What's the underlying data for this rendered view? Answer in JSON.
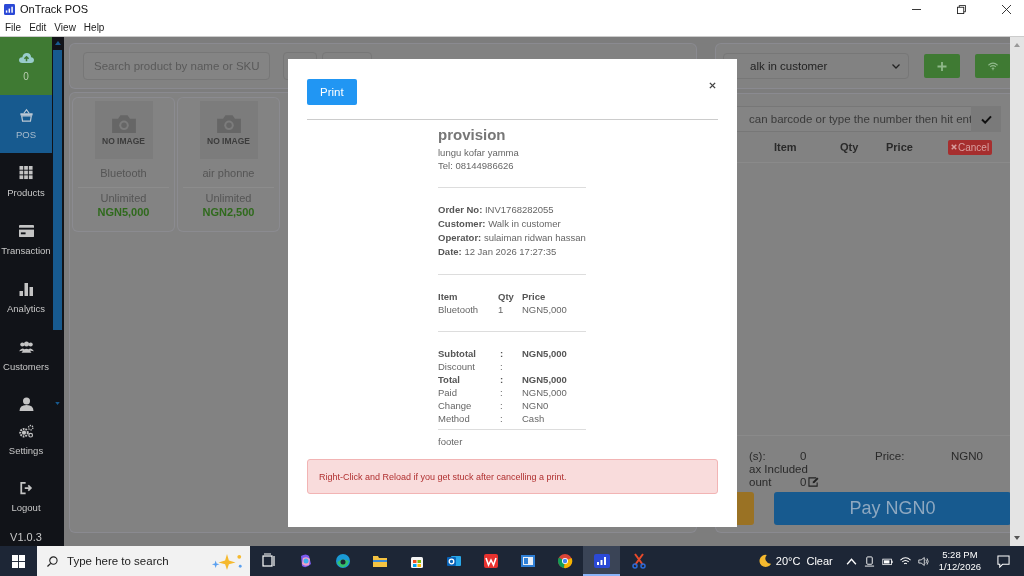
{
  "window": {
    "title": "OnTrack POS"
  },
  "menu": [
    "File",
    "Edit",
    "View",
    "Help"
  ],
  "sidebar": {
    "sync": {
      "count": "0"
    },
    "items": [
      {
        "label": "POS",
        "kind": "basket",
        "selected": true
      },
      {
        "label": "Products",
        "kind": "grid",
        "selected": false
      },
      {
        "label": "Transaction",
        "kind": "card",
        "selected": false
      },
      {
        "label": "Analytics",
        "kind": "bars",
        "selected": false
      },
      {
        "label": "Customers",
        "kind": "users",
        "selected": false
      }
    ],
    "bottom_items": [
      {
        "label": "Settings",
        "kind": "gears",
        "selected": false
      },
      {
        "label": "Logout",
        "kind": "logout",
        "selected": false
      }
    ],
    "version": "V1.0.3"
  },
  "products": {
    "search": {
      "placeholder": "Search product by name or SKU"
    },
    "items": [
      {
        "image_text": "NO IMAGE",
        "name": "Bluetooth",
        "stock": "Unlimited",
        "price": "NGN5,000"
      },
      {
        "image_text": "NO IMAGE",
        "name": "air phonne",
        "stock": "Unlimited",
        "price": "NGN2,500"
      }
    ]
  },
  "cart": {
    "customer": "alk in customer",
    "barcode_placeholder": "can barcode or type the number then hit ent",
    "columns": [
      "Item",
      "Qty",
      "Price"
    ],
    "cancel": "Cancel",
    "summary": {
      "items_label": "(s):",
      "items_value": "0",
      "price_label": "Price:",
      "price_value": "NGN0",
      "tax_label": "ax Included",
      "discount_label": "ount",
      "discount_value": "0"
    },
    "pay": "Pay NGN0"
  },
  "modal": {
    "print": "Print",
    "receipt": {
      "store": "provision",
      "address": "lungu kofar yamma",
      "phone": "Tel: 08144986626",
      "info": [
        {
          "label": "Order No:",
          "value": "INV1768282055"
        },
        {
          "label": "Customer:",
          "value": "Walk in customer"
        },
        {
          "label": "Operator:",
          "value": "sulaiman ridwan hassan"
        },
        {
          "label": "Date:",
          "value": "12 Jan 2026 17:27:35"
        }
      ],
      "columns": [
        "Item",
        "Qty",
        "Price"
      ],
      "lines": [
        {
          "item": "Bluetooth",
          "qty": "1",
          "price": "NGN5,000"
        }
      ],
      "totals": [
        {
          "label": "Subtotal",
          "sep": ":",
          "value": "NGN5,000",
          "bold": true
        },
        {
          "label": "Discount",
          "sep": ":",
          "bold": false
        },
        {
          "label": "Total",
          "sep": ":",
          "value": "NGN5,000",
          "bold": true
        },
        {
          "label": "Paid",
          "sep": ":",
          "value": "NGN5,000",
          "bold": false
        },
        {
          "label": "Change",
          "sep": ":",
          "value": "NGN0",
          "bold": false
        },
        {
          "label": "Method",
          "sep": ":",
          "value": "Cash",
          "bold": false
        }
      ],
      "footer": "footer"
    },
    "alert": "Right-Click and Reload if you get stuck after cancelling a print."
  },
  "taskbar": {
    "search_placeholder": "Type here to search",
    "apps": [
      {
        "kind": "taskview",
        "selected": false
      },
      {
        "kind": "copilot",
        "selected": false
      },
      {
        "kind": "edge",
        "selected": false
      },
      {
        "kind": "folder",
        "selected": false
      },
      {
        "kind": "store",
        "selected": false
      },
      {
        "kind": "mail",
        "selected": false
      },
      {
        "kind": "office",
        "selected": false
      },
      {
        "kind": "reader",
        "selected": false
      },
      {
        "kind": "chrome",
        "selected": false
      },
      {
        "kind": "pos",
        "selected": true
      },
      {
        "kind": "tool",
        "selected": false
      }
    ],
    "temperature": "20°C",
    "condition": "Clear",
    "time": "5:28 PM",
    "date": "1/12/2026"
  }
}
